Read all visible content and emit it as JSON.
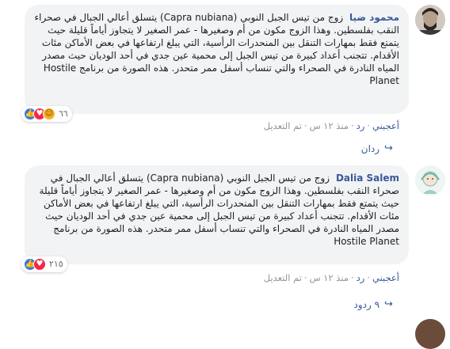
{
  "comments": [
    {
      "author": "محمود ضيا",
      "text": "زوج من تيس الجبل النوبي (Capra nubiana) يتسلق أعالي الجبال في صحراء النقب بفلسطين. وهذا الزوج مكون من أم وصغيرها - عمر الصغير لا يتجاوز أياماً قليلة حيث يتمتع فقط بمهارات التنقل بين المنحدرات الرأسية، التي يبلغ ارتفاعها في بعض الأماكن مئات الأقدام. تتجنب أعداد كبيرة من تيس الجبل إلى محمية عين جدي في أحد الوديان حيث مصدر المياه النادرة في الصحراء والتي تنساب أسفل ممر متحدر. هذه الصورة من برنامج Hostile Planet",
      "reaction_count": "٦٦",
      "reactions": [
        "like-icon",
        "love-icon",
        "haha-icon"
      ],
      "like_label": "أعجبني",
      "reply_label": "رد",
      "time": "منذ ١٢ س",
      "edited": "تم التعديل",
      "replies_label": "ردان"
    },
    {
      "author": "Dalia Salem",
      "text": "زوج من تيس الجبل النوبي (Capra nubiana) يتسلق أعالي الجبال في صحراء النقب بفلسطين. وهذا الزوج مكون من أم وصغيرها - عمر الصغير لا يتجاوز أياماً قليلة حيث يتمتع فقط بمهارات التنقل بين المنحدرات الرأسية، التي يبلغ ارتفاعها في بعض الأماكن مئات الأقدام. تتجنب أعداد كبيرة من تيس الجبل إلى محمية عين جدي في أحد الوديان حيث مصدر المياه النادرة في الصحراء والتي تنساب أسفل ممر متحدر. هذه الصورة من برنامج Hostile Planet",
      "reaction_count": "٢١٥",
      "reactions": [
        "like-icon",
        "love-icon"
      ],
      "like_label": "أعجبني",
      "reply_label": "رد",
      "time": "منذ ١٢ س",
      "edited": "تم التعديل",
      "replies_label": "٩ ردود"
    }
  ],
  "separator": "·",
  "colors": {
    "link": "#385898",
    "bubble": "#f2f3f5",
    "meta": "#90949c",
    "like": "#3578e5",
    "love": "#f0284a",
    "haha": "#f7b125"
  }
}
